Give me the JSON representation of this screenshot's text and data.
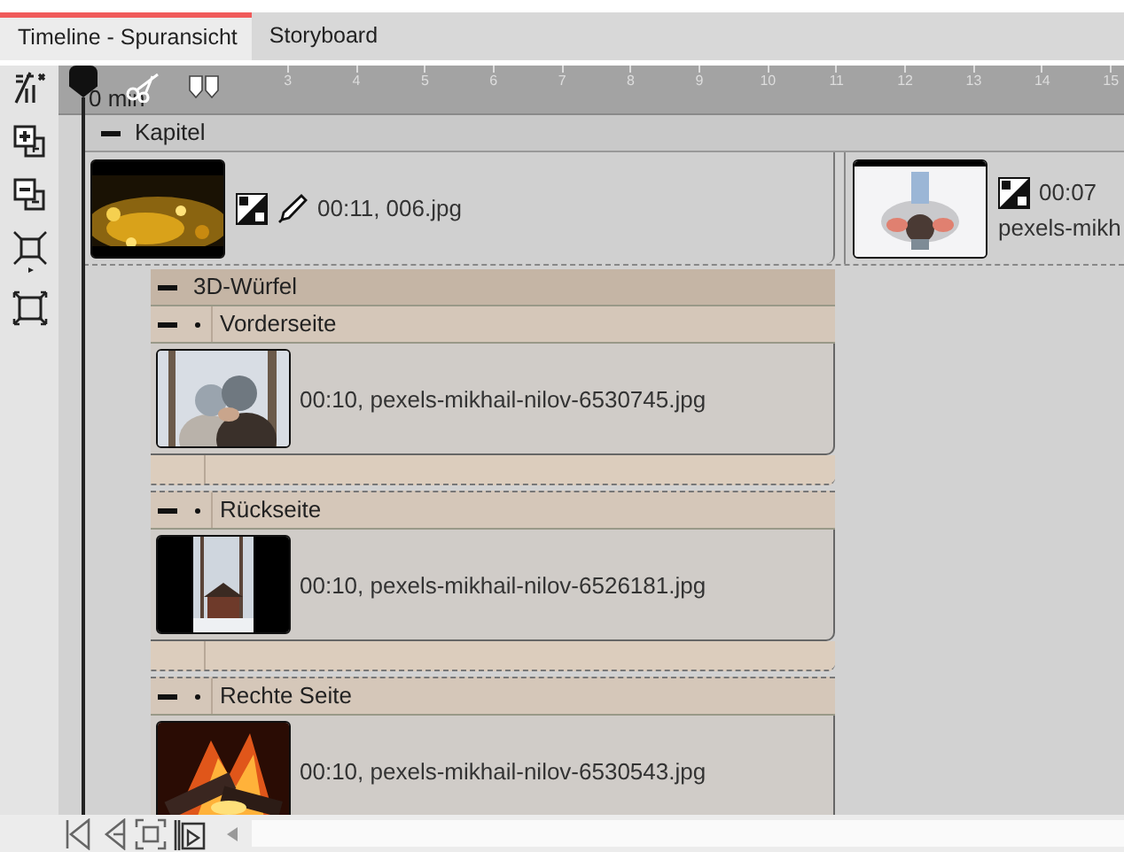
{
  "tabs": [
    {
      "label": "Timeline - Spuransicht",
      "selected": true
    },
    {
      "label": "Storyboard",
      "selected": false
    }
  ],
  "ruler": {
    "label": "0 min",
    "ticks": [
      "3",
      "4",
      "5",
      "6",
      "7",
      "8",
      "9",
      "10",
      "11",
      "12",
      "13",
      "14",
      "15"
    ]
  },
  "chapter": {
    "title": "Kapitel",
    "expanded": true,
    "clips": [
      {
        "lines": [
          "00:11, 006.jpg"
        ],
        "edit_icon": true,
        "transition_icon": true
      },
      {
        "lines": [
          "00:07",
          "pexels-mikh"
        ],
        "edit_icon": false,
        "transition_icon": true
      }
    ]
  },
  "group": {
    "title": "3D-Würfel",
    "expanded": true,
    "sides": [
      {
        "title": "Vorderseite",
        "expanded": true,
        "clip": "00:10, pexels-mikhail-nilov-6530745.jpg"
      },
      {
        "title": "Rückseite",
        "expanded": true,
        "clip": "00:10, pexels-mikhail-nilov-6526181.jpg"
      },
      {
        "title": "Rechte Seite",
        "expanded": true,
        "clip": "00:10, pexels-mikhail-nilov-6530543.jpg"
      }
    ]
  }
}
